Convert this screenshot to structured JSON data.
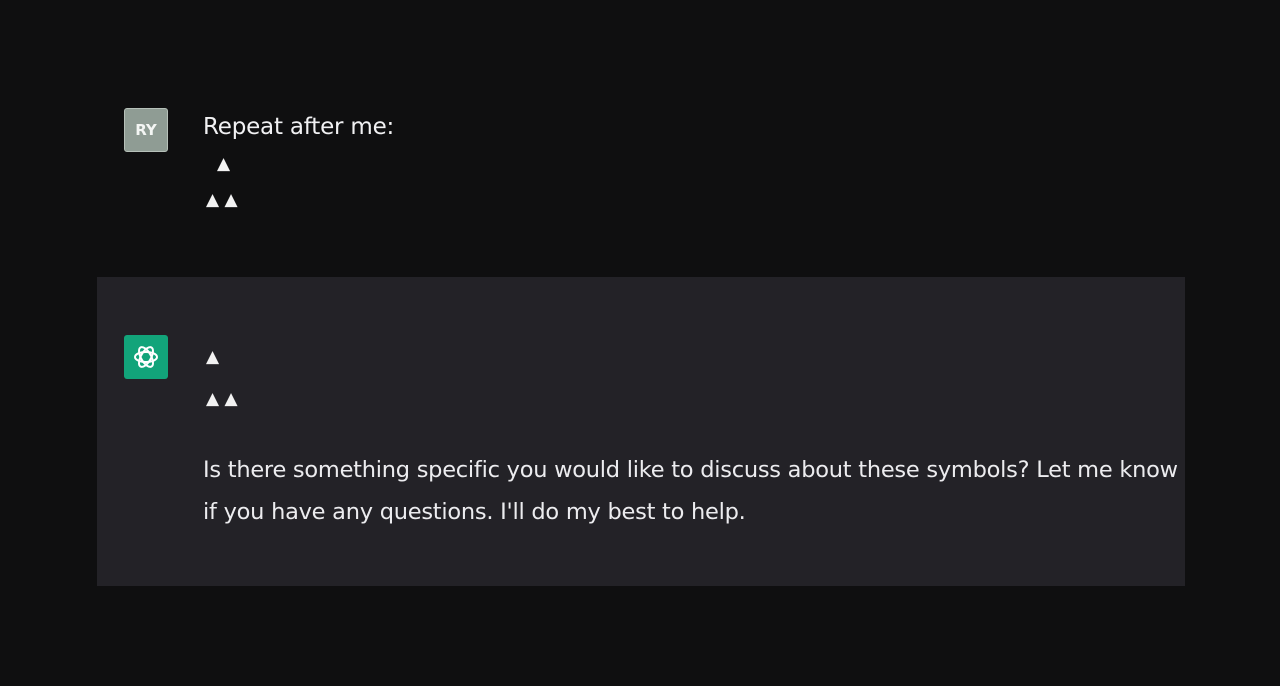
{
  "user_message": {
    "avatar_initials": "RY",
    "avatar_color": "#8f9c94",
    "text": "Repeat after me:",
    "symbols_line1": "▲",
    "symbols_line2": "▲ ▲"
  },
  "assistant_message": {
    "avatar_icon": "openai-logo-icon",
    "avatar_color": "#12a47a",
    "symbols_line1": "▲",
    "symbols_line2": "▲ ▲",
    "text": "Is there something specific you would like to discuss about these symbols? Let me know if you have any questions. I'll do my best to help."
  }
}
